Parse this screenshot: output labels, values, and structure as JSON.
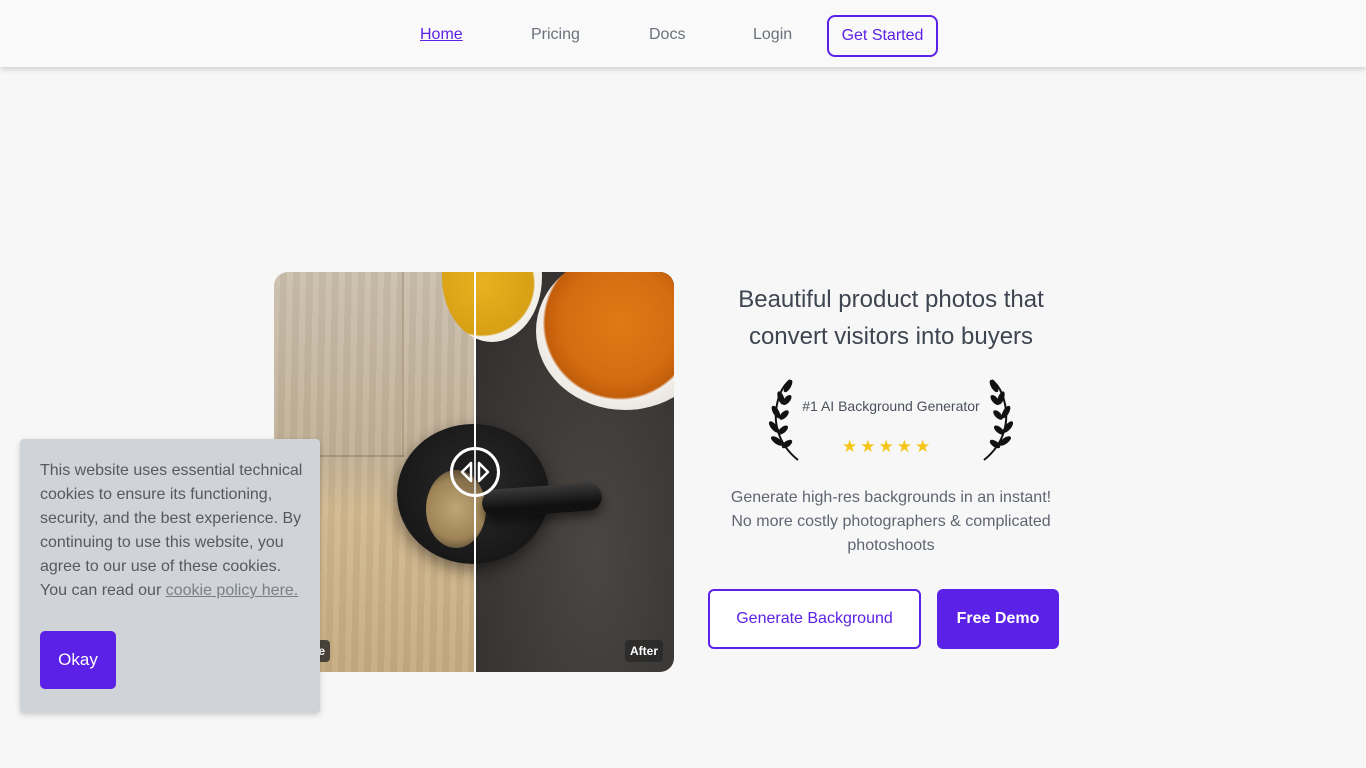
{
  "nav": {
    "home": "Home",
    "pricing": "Pricing",
    "docs": "Docs",
    "login": "Login",
    "get_started": "Get Started"
  },
  "comparison": {
    "before_label": "Before",
    "after_label": "After"
  },
  "hero": {
    "headline_line1": "Beautiful product photos that",
    "headline_line2": "convert visitors into buyers",
    "award_text": "#1 AI Background Generator",
    "rating_stars": 5,
    "subtext_line1": "Generate high-res backgrounds in an instant!",
    "subtext_line2": "No more costly photographers & complicated",
    "subtext_line3": "photoshoots",
    "generate_button": "Generate Background",
    "demo_button": "Free Demo"
  },
  "cookie": {
    "message": "This website uses essential technical cookies to ensure its functioning, security, and the best experience. By continuing to use this website, you agree to our use of these cookies. You can read our ",
    "link_text": "cookie policy here.",
    "button": "Okay"
  },
  "colors": {
    "accent": "#5b21e6",
    "star": "#f5c518",
    "background": "#f7f7f7",
    "cookie_bg": "#d0d3d7"
  }
}
